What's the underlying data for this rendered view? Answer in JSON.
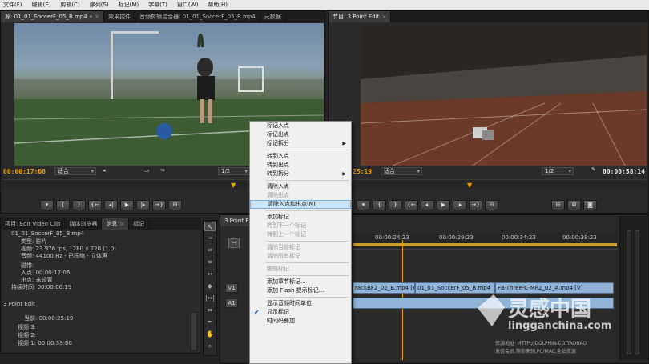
{
  "menubar": [
    "文件(F)",
    "编辑(E)",
    "剪辑(C)",
    "序列(S)",
    "标记(M)",
    "字幕(T)",
    "窗口(W)",
    "帮助(H)"
  ],
  "source_monitor": {
    "tabs": [
      {
        "label": "源: 01_01_SoccerF_05_B.mp4",
        "active": true
      },
      {
        "label": "效果控件",
        "active": false
      },
      {
        "label": "音频剪辑混合器: 01_01_SoccerF_05_B.mp4",
        "active": false
      },
      {
        "label": "元数据",
        "active": false
      }
    ],
    "timecode": "00:00:17:06",
    "fit": "适合",
    "resolution": "1/2"
  },
  "program_monitor": {
    "tab": "节目: 3 Point Edit",
    "timecode_left": "25:19",
    "fit": "适合",
    "resolution": "1/2",
    "timecode_right": "00:00:58:14"
  },
  "project_panel": {
    "tabs": [
      {
        "label": "项目: Edit Video Clip",
        "active": false
      },
      {
        "label": "媒体浏览器",
        "active": false
      },
      {
        "label": "信息",
        "active": true
      },
      {
        "label": "标记",
        "active": false
      }
    ],
    "lines": [
      "01_01_SoccerF_05_B.mp4",
      "类型: 影片",
      "视频: 23.976 fps, 1280 x 720 (1.0)",
      "音频: 44100 Hz - 已压缩 - 立体声",
      "磁带:",
      "入点: 00:00:17:06",
      "出点: 未设置",
      "持续时间: 00:00:06:19"
    ],
    "sequence_name": "3 Point Edit",
    "seq_lines": [
      "当前: 00:00:25:19",
      "视频 3:",
      "视频 2:",
      "视频 1: 00:00:39:00"
    ]
  },
  "timeline": {
    "tab": "3 Point E",
    "ruler_marks": [
      "00:00:24:23",
      "00:00:29:23",
      "00:00:34:23",
      "00:00:39:23"
    ],
    "tracks": [
      "V1",
      "A1"
    ],
    "clips": [
      "rackBF2_02_B.mp4 [V]",
      "01_01_SoccerF_05_B.mp4",
      "FB-Three-C-MP2_02_A.mp4 [V]"
    ]
  },
  "context_menu": {
    "items": [
      {
        "label": "标记入点",
        "state": "normal"
      },
      {
        "label": "标记出点",
        "state": "normal"
      },
      {
        "label": "标记拆分",
        "state": "normal",
        "submenu": true
      },
      {
        "sep": true
      },
      {
        "label": "转到入点",
        "state": "normal"
      },
      {
        "label": "转到出点",
        "state": "normal"
      },
      {
        "label": "转到拆分",
        "state": "normal",
        "submenu": true
      },
      {
        "sep": true
      },
      {
        "label": "清除入点",
        "state": "normal"
      },
      {
        "label": "清除出点",
        "state": "disabled"
      },
      {
        "label": "清除入点和出点(N)",
        "state": "highlight"
      },
      {
        "sep": true
      },
      {
        "label": "添加标记",
        "state": "normal"
      },
      {
        "label": "转到下一个标记",
        "state": "disabled"
      },
      {
        "label": "转到上一个标记",
        "state": "disabled"
      },
      {
        "sep": true
      },
      {
        "label": "清除当前标记",
        "state": "disabled"
      },
      {
        "label": "清除所有标记",
        "state": "disabled"
      },
      {
        "sep": true
      },
      {
        "label": "编辑标记...",
        "state": "disabled"
      },
      {
        "sep": true
      },
      {
        "label": "添加章节标记...",
        "state": "normal"
      },
      {
        "label": "添加 Flash 提示标记...",
        "state": "normal"
      },
      {
        "sep": true
      },
      {
        "label": "显示音频时间单位",
        "state": "normal"
      },
      {
        "label": "显示标记",
        "state": "checked"
      },
      {
        "label": "时间码叠加",
        "state": "normal"
      }
    ]
  },
  "watermark": {
    "brand": "灵感中国",
    "url": "lingganchina.com",
    "line1": "资源地址: HTTP://DOLPHIN-CG.TAOBAO",
    "line2": "发信会员,等你来领,PC/MAC,全站资源"
  },
  "colors": {
    "accent": "#f0a000",
    "menu_bg": "#f0f0f0",
    "clip": "#8fb4d8"
  }
}
